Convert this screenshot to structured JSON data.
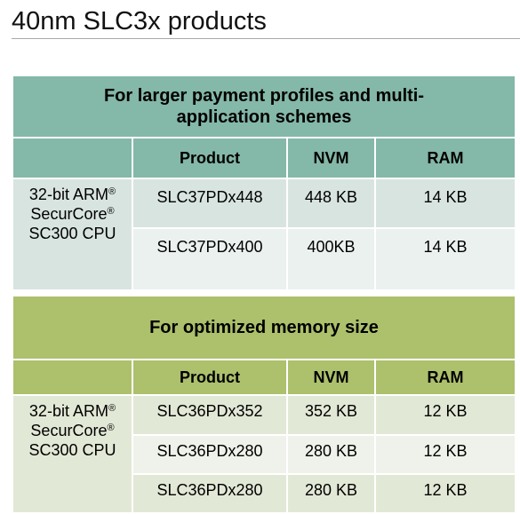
{
  "page": {
    "title": "40nm SLC3x products"
  },
  "tables": [
    {
      "banner": "For larger payment profiles and multi-application schemes",
      "banner_line1": "For larger payment profiles and multi-",
      "banner_line2": "application schemes",
      "accent_color": "#84b8a8",
      "columns": [
        "",
        "Product",
        "NVM",
        "RAM"
      ],
      "cpu": {
        "line1": "32-bit ARM",
        "line2": "SecurCore",
        "line3": "SC300 CPU",
        "reg_mark": "®"
      },
      "rows": [
        {
          "product": "SLC37PDx448",
          "nvm": "448 KB",
          "ram": "14 KB"
        },
        {
          "product": "SLC37PDx400",
          "nvm": "400KB",
          "ram": "14 KB"
        }
      ]
    },
    {
      "banner": "For optimized memory size",
      "accent_color": "#adc06c",
      "columns": [
        "",
        "Product",
        "NVM",
        "RAM"
      ],
      "cpu": {
        "line1": "32-bit ARM",
        "line2": "SecurCore",
        "line3": "SC300 CPU",
        "reg_mark": "®"
      },
      "rows": [
        {
          "product": "SLC36PDx352",
          "nvm": "352 KB",
          "ram": "12 KB"
        },
        {
          "product": "SLC36PDx280",
          "nvm": "280 KB",
          "ram": "12 KB"
        },
        {
          "product": "SLC36PDx280",
          "nvm": "280 KB",
          "ram": "12 KB"
        }
      ]
    }
  ]
}
